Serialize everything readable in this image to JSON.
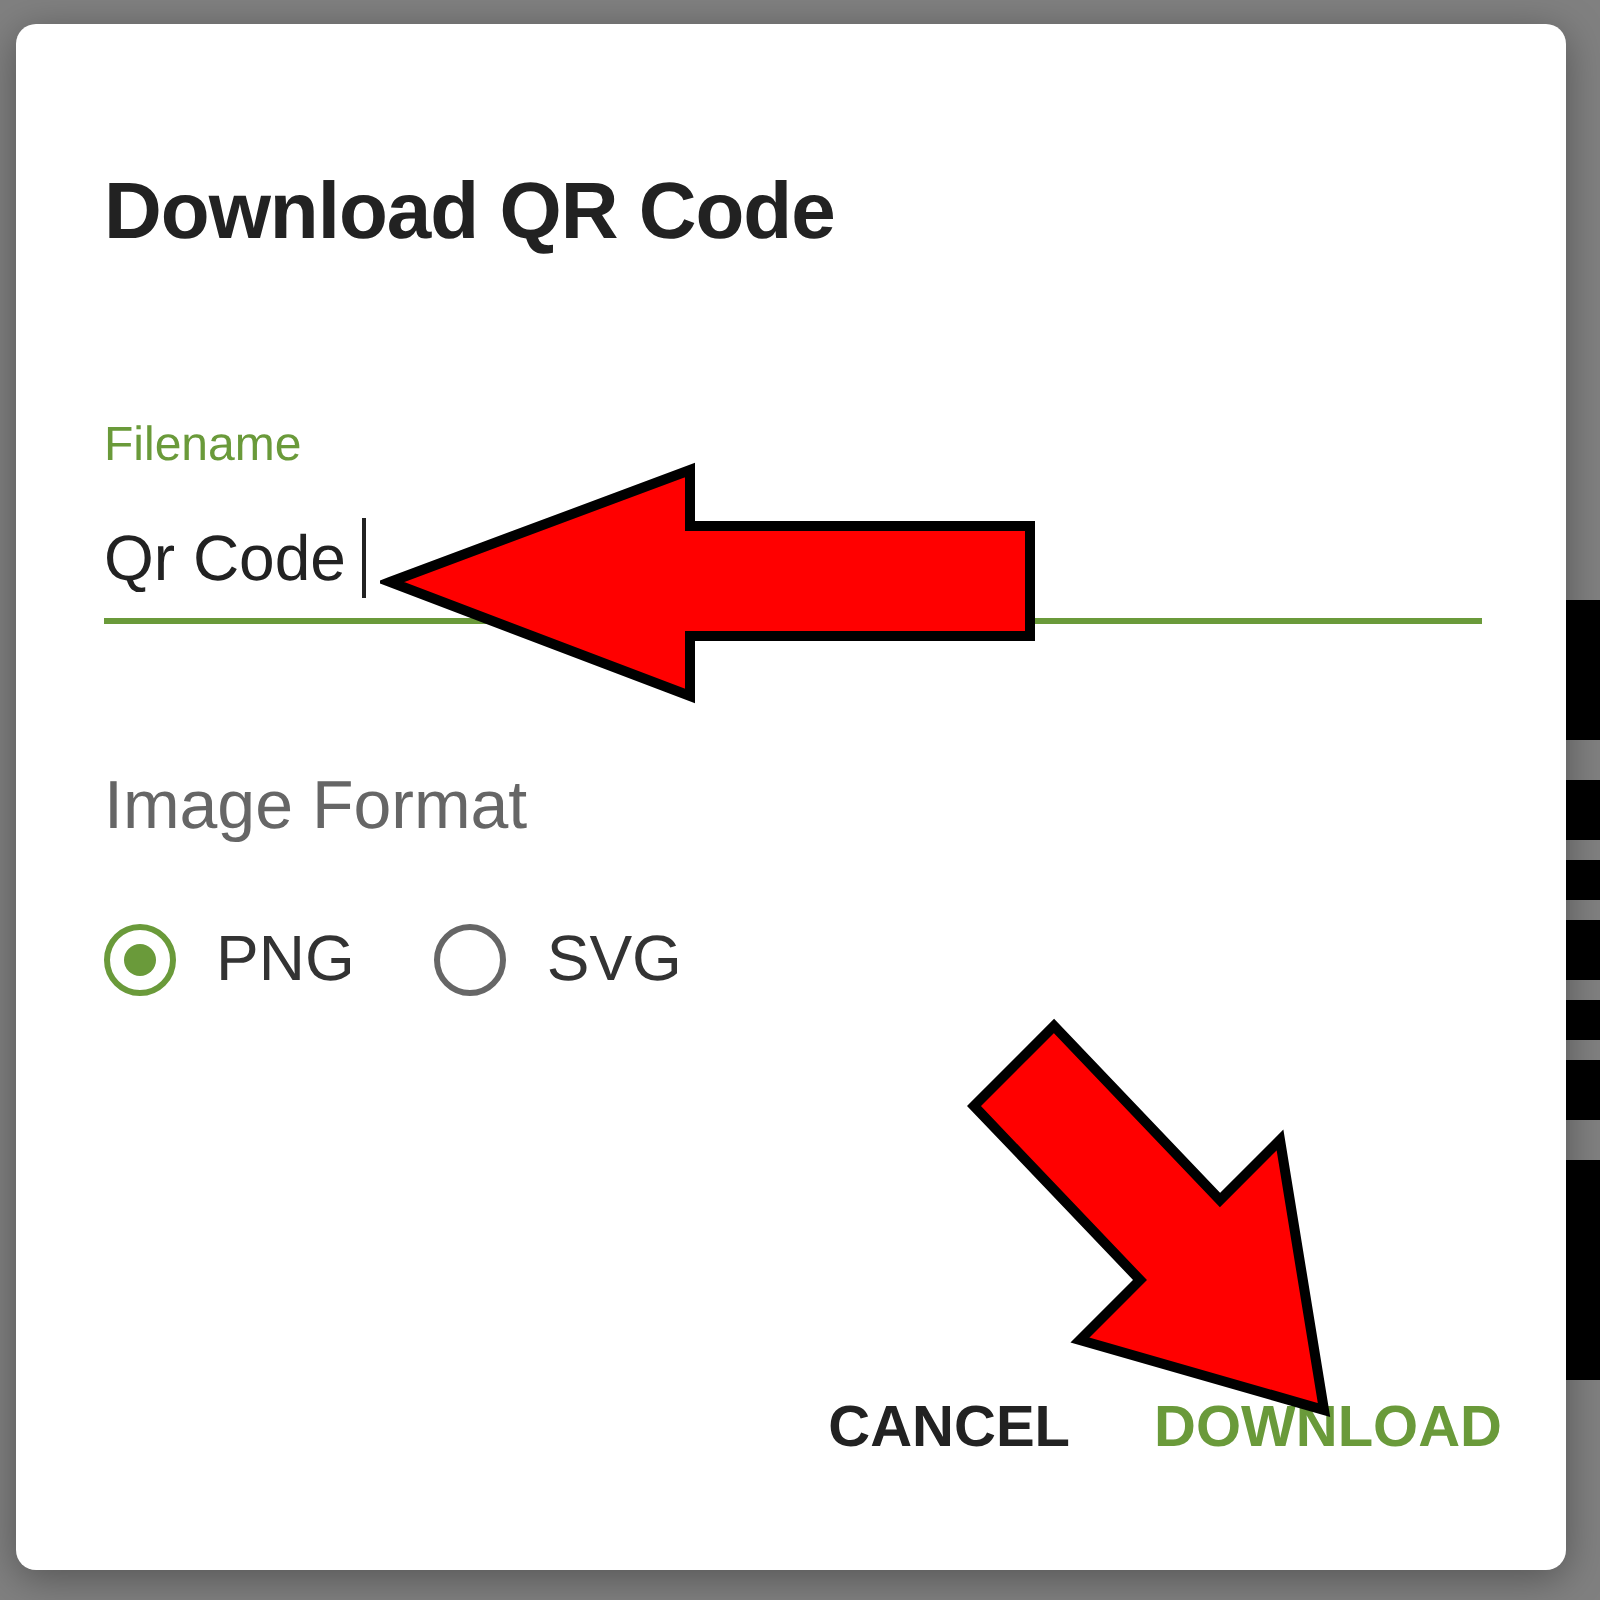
{
  "dialog": {
    "title": "Download QR Code",
    "filename_field": {
      "label": "Filename",
      "value": "Qr Code",
      "focused": true
    },
    "image_format": {
      "label": "Image Format",
      "options": [
        {
          "label": "PNG",
          "selected": true
        },
        {
          "label": "SVG",
          "selected": false
        }
      ]
    },
    "buttons": [
      {
        "label": "CANCEL",
        "kind": "secondary"
      },
      {
        "label": "DOWNLOAD",
        "kind": "primary"
      }
    ]
  }
}
